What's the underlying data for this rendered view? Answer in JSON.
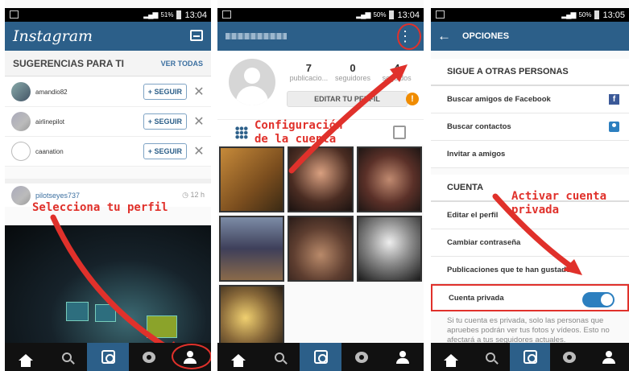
{
  "status": {
    "time": "13:04",
    "battery1": "51%",
    "battery2": "50%",
    "time3": "13:05"
  },
  "p1": {
    "logo": "Instagram",
    "suggestions_title": "SUGERENCIAS PARA TI",
    "see_all": "VER TODAS",
    "suggestions": [
      {
        "name": "amandio82",
        "button": "+ SEGUIR"
      },
      {
        "name": "airlinepilot",
        "button": "+ SEGUIR"
      },
      {
        "name": "caanation",
        "button": "+ SEGUIR"
      }
    ],
    "close_glyph": "✕",
    "post_user": "pilotseyes737",
    "post_time": "◷ 12 h",
    "annotation": "Selecciona tu perfil"
  },
  "p2": {
    "kebab": "⋮",
    "stats": [
      {
        "num": "7",
        "label": "publicacio..."
      },
      {
        "num": "0",
        "label": "seguidores"
      },
      {
        "num": "4",
        "label": "seguidos"
      }
    ],
    "edit_button": "EDITAR TU PERFIL",
    "warn": "!",
    "annotation_line1": "Configuración",
    "annotation_line2": "de la cuenta"
  },
  "p3": {
    "back": "←",
    "title": "OPCIONES",
    "section1": "SIGUE A OTRAS PERSONAS",
    "rows1": [
      "Buscar amigos de Facebook",
      "Buscar contactos",
      "Invitar a amigos"
    ],
    "fb_glyph": "f",
    "section2": "CUENTA",
    "rows2": [
      "Editar el perfil",
      "Cambiar contraseña",
      "Publicaciones que te han gustado"
    ],
    "private_label": "Cuenta privada",
    "private_on": true,
    "private_note": "Si tu cuenta es privada, solo las personas que apruebes podrán ver tus fotos y vídeos. Esto no afectará a tus seguidores actuales.",
    "annotation_line1": "Activar cuenta",
    "annotation_line2": "privada"
  },
  "colors": {
    "appbar": "#2c5f89",
    "annotation": "#e0312b",
    "toggle": "#2c7fbf"
  },
  "nav_icons": [
    "home-icon",
    "search-icon",
    "camera-icon",
    "activity-icon",
    "profile-icon"
  ]
}
